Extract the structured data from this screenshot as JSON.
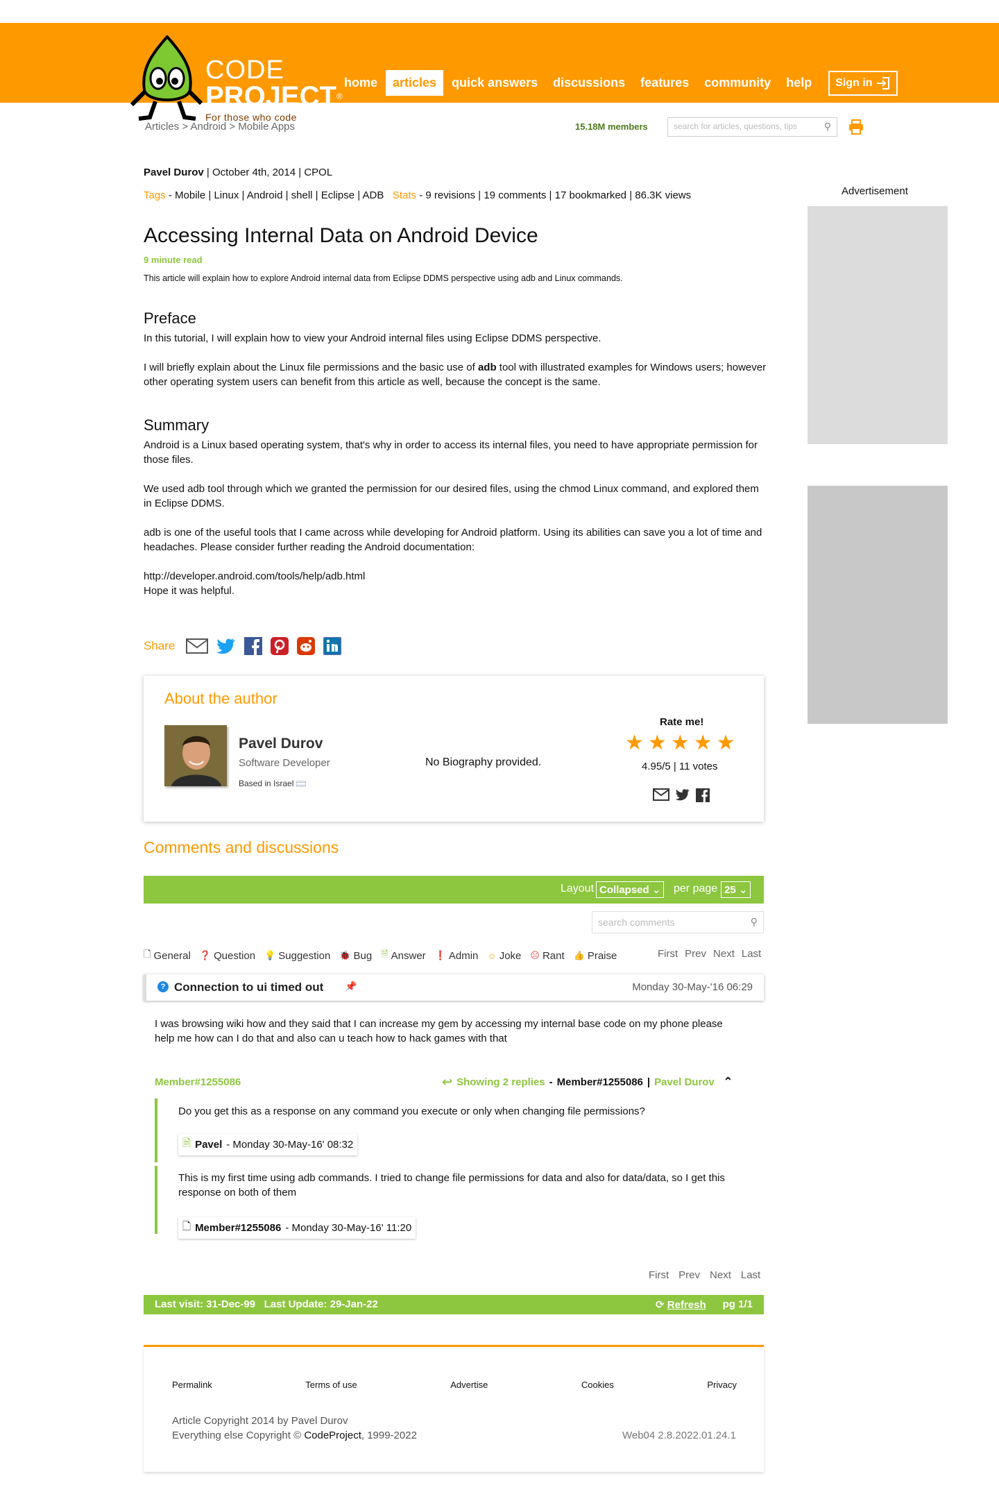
{
  "header": {
    "logo_code": "CODE",
    "logo_project": "PROJECT",
    "logo_tagline": "For those who code",
    "nav": [
      "home",
      "articles",
      "quick answers",
      "discussions",
      "features",
      "community",
      "help"
    ],
    "active_nav": "articles",
    "signin": "Sign in",
    "brand_color": "#ff9900"
  },
  "breadcrumb": {
    "items": [
      "Articles",
      "Android",
      "Mobile Apps"
    ],
    "sep": ">"
  },
  "members": "15.18M members",
  "search_placeholder": "search for articles, questions, tips",
  "article": {
    "author": "Pavel Durov",
    "date": "October 4th, 2014",
    "license": "CPOL",
    "tags_label": "Tags",
    "tags": [
      "Mobile",
      "Linux",
      "Android",
      "shell",
      "Eclipse",
      "ADB"
    ],
    "stats_label": "Stats",
    "revisions": "9 revisions",
    "comments": "19 comments",
    "bookmarked": "17 bookmarked",
    "views": "86.3K views",
    "title": "Accessing Internal Data on Android Device",
    "read_time": "9 minute read",
    "description": "This article will explain how to explore Android internal data from Eclipse DDMS perspective using adb and Linux commands.",
    "preface_h": "Preface",
    "preface_p1": "In this tutorial, I will explain how to view your Android internal files using Eclipse DDMS perspective.",
    "preface_p2_a": "I will briefly explain about the Linux file permissions and the basic use of ",
    "preface_p2_b": "adb",
    "preface_p2_c": " tool with illustrated examples for Windows users; however other operating system users can benefit from this article as well, because the concept is the same.",
    "summary_h": "Summary",
    "summary_p1": "Android is a Linux based operating system, that's why in order to access its internal files, you need to have appropriate permission for those files.",
    "summary_p2": "We used adb tool through which we granted the permission for our desired files, using the chmod Linux command, and explored them in Eclipse DDMS.",
    "summary_p3": "adb is one of the useful tools that I came across while developing for Android platform. Using its abilities can save you a lot of time and headaches. Please consider further reading the Android documentation:",
    "summary_link": "http://developer.android.com/tools/help/adb.html",
    "summary_end": "Hope it was helpful."
  },
  "share": {
    "label": "Share",
    "icons": [
      "email-icon",
      "twitter-icon",
      "facebook-icon",
      "pinterest-icon",
      "reddit-icon",
      "linkedin-icon"
    ]
  },
  "about": {
    "heading": "About the author",
    "name": "Pavel Durov",
    "role": "Software Developer",
    "based": "Based in Israel",
    "bio": "No Biography provided.",
    "rate_label": "Rate me!",
    "rating": 4.95,
    "rating_text": "4.95/5 | 11 votes"
  },
  "comments": {
    "heading": "Comments and discussions",
    "layout_label": "Layout",
    "layout_value": "Collapsed",
    "per_page_label": "per page",
    "per_page_value": "25",
    "search_placeholder": "search comments",
    "filters": [
      {
        "icon": "doc-icon",
        "label": "General"
      },
      {
        "icon": "question-icon",
        "label": "Question"
      },
      {
        "icon": "bulb-icon",
        "label": "Suggestion"
      },
      {
        "icon": "bug-icon",
        "label": "Bug"
      },
      {
        "icon": "answer-icon",
        "label": "Answer"
      },
      {
        "icon": "admin-icon",
        "label": "Admin"
      },
      {
        "icon": "smile-icon",
        "label": "Joke"
      },
      {
        "icon": "frown-icon",
        "label": "Rant"
      },
      {
        "icon": "thumbs-up-icon",
        "label": "Praise"
      }
    ],
    "pager": [
      "First",
      "Prev",
      "Next",
      "Last"
    ],
    "thread": {
      "title": "Connection to ui timed out",
      "date": "Monday 30-May-'16 06:29",
      "body": "I was browsing wiki how and they said that I can increase my gem by accessing my internal base code on my phone please help me how can I do that and also can u teach how to hack games with that",
      "member": "Member#1255086",
      "replies_link": "Showing 2 replies",
      "replies_sep": " - ",
      "replies_member": "Member#1255086",
      "replies_pipe": " | ",
      "replies_author": "Pavel Durov"
    },
    "replies": [
      {
        "text": "Do you get this as a response on any command you execute or only when changing file permissions?",
        "author": "Pavel",
        "date": "- Monday 30-May-16' 08:32"
      },
      {
        "text": "This is my first time using adb commands. I tried to change file permissions for data and also for data/data, so I get this response on both of them",
        "author": "Member#1255086",
        "date": "- Monday 30-May-16' 11:20"
      }
    ],
    "last_visit": "Last visit: 31-Dec-99",
    "last_update": "Last Update: 29-Jan-22",
    "refresh": "Refresh",
    "page": "pg 1/1"
  },
  "footer": {
    "links": [
      "Permalink",
      "Terms of use",
      "Advertise",
      "Cookies",
      "Privacy"
    ],
    "copy1": "Article Copyright 2014 by Pavel Durov",
    "copy2_a": "Everything else Copyright © ",
    "copy2_b": "CodeProject",
    "copy2_c": ", 1999-2022",
    "version": "Web04 2.8.2022.01.24.1"
  },
  "advertisement": "Advertisement"
}
